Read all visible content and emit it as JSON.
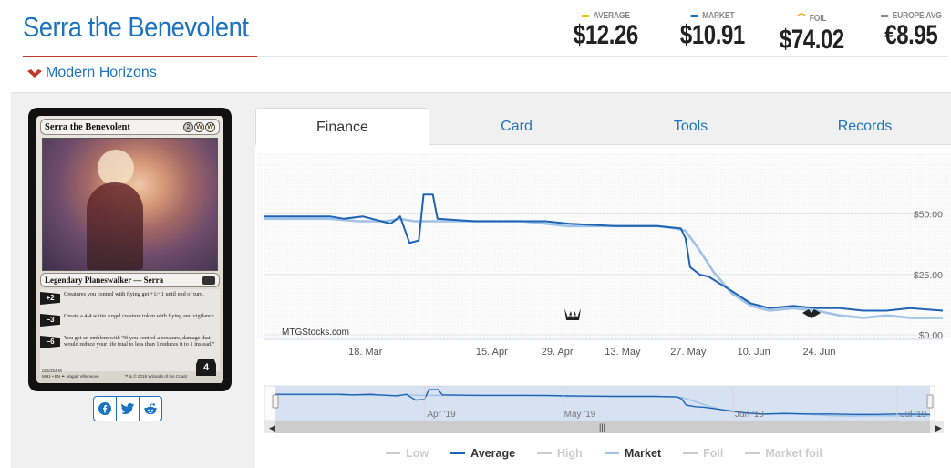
{
  "header": {
    "title": "Serra the Benevolent",
    "set_name": "Modern Horizons",
    "prices": [
      {
        "label": "AVERAGE",
        "value": "$12.26",
        "color": "#f0c419"
      },
      {
        "label": "MARKET",
        "value": "$10.91",
        "color": "#1e73be"
      },
      {
        "label": "FOIL",
        "value": "$74.02",
        "color": "#f39c12"
      },
      {
        "label": "EUROPE AVG",
        "value": "€8.95",
        "color": "#888888"
      }
    ]
  },
  "card": {
    "name": "Serra the Benevolent",
    "mana": [
      "2",
      "W",
      "W"
    ],
    "type_line": "Legendary Planeswalker — Serra",
    "abilities": [
      {
        "cost": "+2",
        "text": "Creatures you control with flying get +1/+1 until end of turn."
      },
      {
        "cost": "−3",
        "text": "Create a 4/4 white Angel creature token with flying and vigilance."
      },
      {
        "cost": "−6",
        "text": "You get an emblem with “If you control a creature, damage that would reduce your life total to less than 1 reduces it to 1 instead.”"
      }
    ],
    "loyalty": "4",
    "footer_line1": "026/254 M",
    "footer_line2": "MH1 • EN  ✒ Magali Villeneuve",
    "copyright": "™ & © 2019 Wizards of the Coast"
  },
  "share_icons": [
    "facebook-icon",
    "twitter-icon",
    "reddit-icon"
  ],
  "tabs": [
    {
      "label": "Finance",
      "active": true
    },
    {
      "label": "Card",
      "active": false
    },
    {
      "label": "Tools",
      "active": false
    },
    {
      "label": "Records",
      "active": false
    }
  ],
  "chart_data": {
    "type": "line",
    "watermark": "MTGStocks.com",
    "x_ticks": [
      "18. Mar",
      "15. Apr",
      "29. Apr",
      "13. May",
      "27. May",
      "10. Jun",
      "24. Jun"
    ],
    "y_ticks": [
      "$50.00",
      "$25.00",
      "$0.00"
    ],
    "ylim": [
      0,
      60
    ],
    "navigator_ticks": [
      "Apr '19",
      "May '19",
      "Jun '19",
      "Jul '19"
    ],
    "series": [
      {
        "name": "Average",
        "color": "#1e64b4",
        "values": [
          [
            0,
            49
          ],
          [
            14,
            49
          ],
          [
            17,
            48
          ],
          [
            21,
            49
          ],
          [
            25,
            47
          ],
          [
            27,
            46
          ],
          [
            29,
            49
          ],
          [
            31,
            38
          ],
          [
            33,
            39
          ],
          [
            34,
            58
          ],
          [
            36,
            58
          ],
          [
            37,
            48
          ],
          [
            45,
            47
          ],
          [
            60,
            47
          ],
          [
            65,
            46
          ],
          [
            75,
            45
          ],
          [
            84,
            45
          ],
          [
            89,
            44
          ],
          [
            90,
            40
          ],
          [
            91,
            28
          ],
          [
            93,
            25
          ],
          [
            95,
            24
          ],
          [
            100,
            18
          ],
          [
            104,
            13
          ],
          [
            108,
            11
          ],
          [
            113,
            12
          ],
          [
            118,
            11
          ],
          [
            123,
            11
          ],
          [
            128,
            10
          ],
          [
            133,
            10
          ],
          [
            138,
            11
          ],
          [
            145,
            10
          ]
        ]
      },
      {
        "name": "Market",
        "color": "#9fc2e6",
        "values": [
          [
            0,
            48
          ],
          [
            14,
            48
          ],
          [
            20,
            47
          ],
          [
            26,
            47
          ],
          [
            29,
            48
          ],
          [
            32,
            47
          ],
          [
            40,
            47
          ],
          [
            55,
            47
          ],
          [
            65,
            45
          ],
          [
            75,
            45
          ],
          [
            84,
            45
          ],
          [
            88,
            44
          ],
          [
            90,
            43
          ],
          [
            93,
            35
          ],
          [
            96,
            26
          ],
          [
            100,
            17
          ],
          [
            104,
            12
          ],
          [
            108,
            10
          ],
          [
            113,
            11
          ],
          [
            118,
            10
          ],
          [
            123,
            8
          ],
          [
            128,
            7
          ],
          [
            133,
            8
          ],
          [
            138,
            7
          ],
          [
            145,
            7
          ]
        ]
      }
    ],
    "legend": [
      {
        "name": "Low",
        "color": "#cccccc",
        "active": false
      },
      {
        "name": "Average",
        "color": "#1e64b4",
        "active": true
      },
      {
        "name": "High",
        "color": "#cccccc",
        "active": false
      },
      {
        "name": "Market",
        "color": "#9fc2e6",
        "active": true
      },
      {
        "name": "Foil",
        "color": "#cccccc",
        "active": false
      },
      {
        "name": "Market foil",
        "color": "#cccccc",
        "active": false
      }
    ]
  }
}
